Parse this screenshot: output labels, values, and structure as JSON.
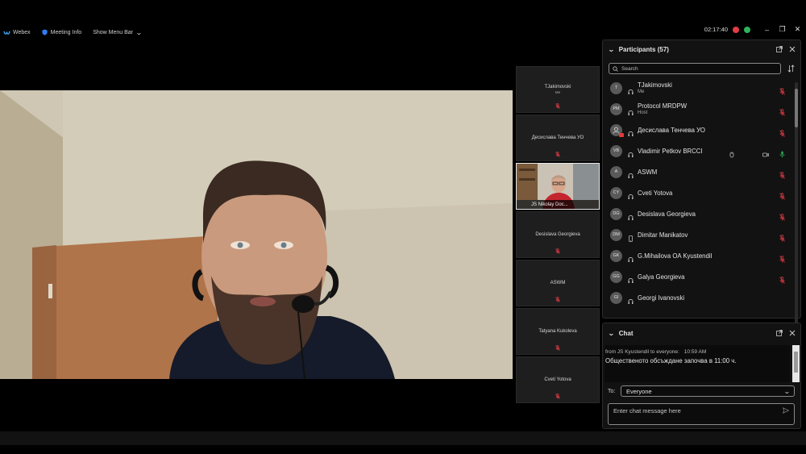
{
  "topbar": {
    "app_name": "Webex",
    "meeting_info": "Meeting Info",
    "show_menu_bar": "Show Menu Bar",
    "timer": "02:17:40"
  },
  "tiles": [
    {
      "name": "TJakimovski",
      "sub": "Me"
    },
    {
      "name": "Десислава Тенчева УО",
      "sub": ""
    },
    {
      "name": "JS Nikolay Doc...",
      "sub": "",
      "video": true
    },
    {
      "name": "Desislava Georgieva",
      "sub": ""
    },
    {
      "name": "ASWM",
      "sub": ""
    },
    {
      "name": "Tatyana Kukoleva",
      "sub": ""
    },
    {
      "name": "Cveti Yotova",
      "sub": ""
    }
  ],
  "participants": {
    "title": "Participants (57)",
    "search_placeholder": "Search",
    "items": [
      {
        "initials": "T",
        "name": "TJakimovski",
        "role": "Me",
        "mic": "muted"
      },
      {
        "initials": "PM",
        "name": "Protocol MRDPW",
        "role": "Host",
        "mic": "muted"
      },
      {
        "initials": "",
        "name": "Десислава Тенчева УО",
        "role": "",
        "mic": "muted",
        "badge": true
      },
      {
        "initials": "VB",
        "name": "Vladimir Petkov BRCCI",
        "role": "",
        "mic": "active",
        "extras": true
      },
      {
        "initials": "A",
        "name": "ASWM",
        "role": "",
        "mic": "muted"
      },
      {
        "initials": "CY",
        "name": "Cveti Yotova",
        "role": "",
        "mic": "muted"
      },
      {
        "initials": "DG",
        "name": "Desislava Georgieva",
        "role": "",
        "mic": "muted"
      },
      {
        "initials": "DM",
        "name": "Dimitar Manikatov",
        "role": "",
        "mic": "muted",
        "phone": true
      },
      {
        "initials": "GK",
        "name": "G.Mihailova OA Kyustendil",
        "role": "",
        "mic": "muted"
      },
      {
        "initials": "GG",
        "name": "Galya Georgieva",
        "role": "",
        "mic": "muted"
      },
      {
        "initials": "GI",
        "name": "Georgi Ivanovski",
        "role": "",
        "mic": "none"
      }
    ]
  },
  "chat": {
    "title": "Chat",
    "message": {
      "from": "from JS Kyustendil to everyone:",
      "time": "10:59 AM",
      "text": "Общественото обсъждане започва в 11:00 ч."
    },
    "to_label": "To:",
    "to_value": "Everyone",
    "input_placeholder": "Enter chat message here"
  },
  "colors": {
    "accent_blue": "#2e7ef2",
    "mute_red": "#e23d45",
    "active_green": "#2fb25b"
  }
}
